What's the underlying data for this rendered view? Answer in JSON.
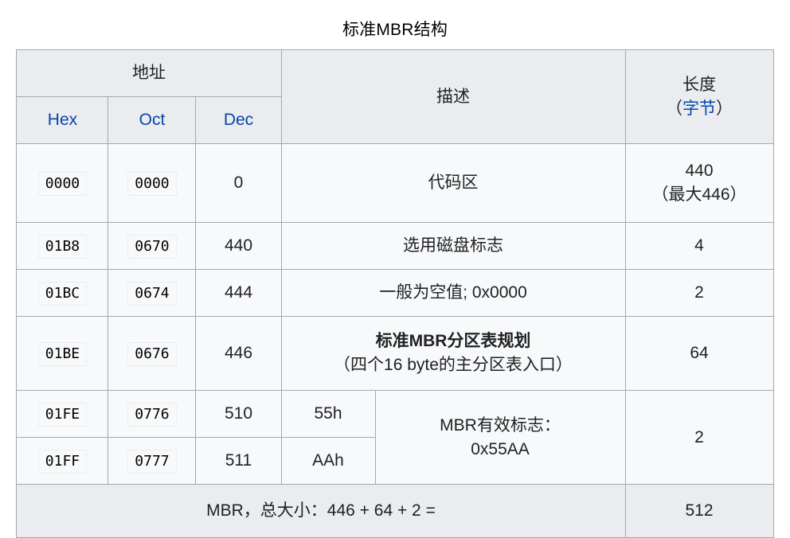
{
  "caption": "标准MBR结构",
  "table": {
    "headers": {
      "address_group": "地址",
      "hex": "Hex",
      "oct": "Oct",
      "dec": "Dec",
      "description": "描述",
      "length_main": "长度",
      "length_paren_open": "（",
      "length_unit": "字节",
      "length_paren_close": "）"
    },
    "rows": [
      {
        "hex": "0000",
        "oct": "0000",
        "dec": "0",
        "desc": "代码区",
        "len_line1": "440",
        "len_line2": "（最大446）"
      },
      {
        "hex": "01B8",
        "oct": "0670",
        "dec": "440",
        "desc": "选用磁盘标志",
        "len_line1": "4",
        "len_line2": ""
      },
      {
        "hex": "01BC",
        "oct": "0674",
        "dec": "444",
        "desc": "一般为空值; 0x0000",
        "len_line1": "2",
        "len_line2": ""
      },
      {
        "hex": "01BE",
        "oct": "0676",
        "dec": "446",
        "desc_line1": "标准MBR分区表规划",
        "desc_line2": "（四个16 byte的主分区表入口）",
        "len_line1": "64",
        "len_line2": ""
      },
      {
        "hex": "01FE",
        "oct": "0776",
        "dec": "510",
        "marker": "55h",
        "sig_line1": "MBR有效标志：",
        "sig_line2": "0x55AA",
        "len_line1": "2",
        "len_line2": ""
      },
      {
        "hex": "01FF",
        "oct": "0777",
        "dec": "511",
        "marker": "AAh"
      }
    ],
    "footer": {
      "summary": "MBR，总大小：446 + 64 + 2 =",
      "total": "512"
    }
  },
  "colors": {
    "link_blue": "#0645ad",
    "border": "#a2a9b1",
    "header_bg": "#eaecf0",
    "cell_bg": "#f8f9fa"
  }
}
